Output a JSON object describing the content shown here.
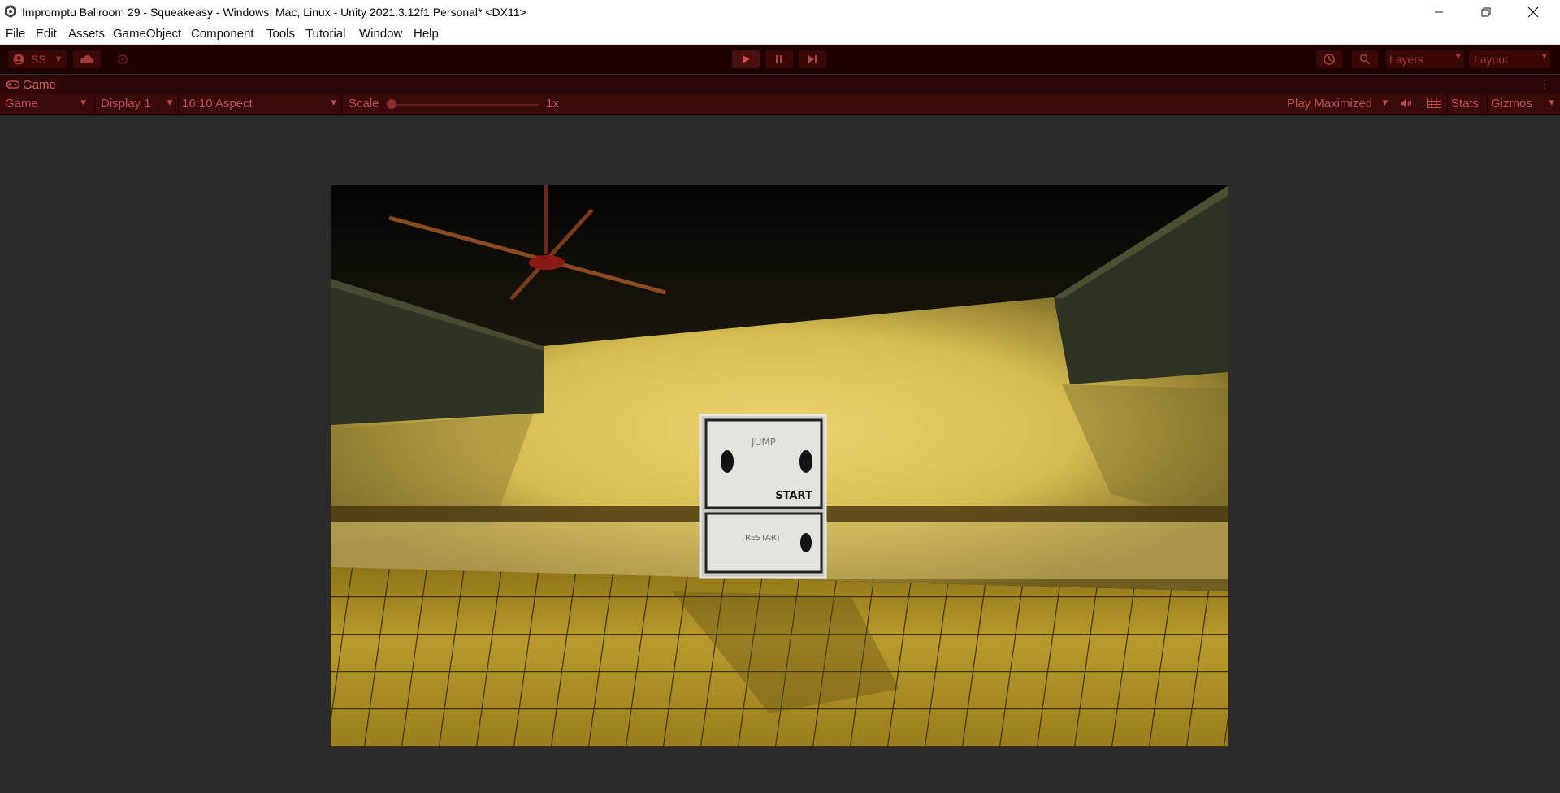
{
  "window": {
    "title": "Impromptu Ballroom 29 - Squeakeasy - Windows, Mac, Linux - Unity 2021.3.12f1 Personal* <DX11>",
    "minimize_icon": "minimize-icon",
    "restore_icon": "restore-icon",
    "close_icon": "close-icon"
  },
  "menu": [
    "File",
    "Edit",
    "Assets",
    "GameObject",
    "Component",
    "Tools",
    "Tutorial",
    "Window",
    "Help"
  ],
  "toolbar": {
    "account_label": "SS",
    "layers_label": "Layers",
    "layout_label": "Layout"
  },
  "game_tab": {
    "label": "Game"
  },
  "game_bar": {
    "mode": "Game",
    "display": "Display 1",
    "aspect": "16:10 Aspect",
    "scale_label": "Scale",
    "scale_value": "1x",
    "play_mode": "Play Maximized",
    "stats": "Stats",
    "gizmos": "Gizmos"
  },
  "scene": {
    "sign_top_text": "JUMP",
    "sign_start_text": "START",
    "sign_bottom_text": "RESTART"
  },
  "colors": {
    "playmode_tint": "#1f0000",
    "viewport_bg": "#2a2a2a",
    "scene_wall": "#e8d068",
    "scene_floor": "#a88a20"
  }
}
